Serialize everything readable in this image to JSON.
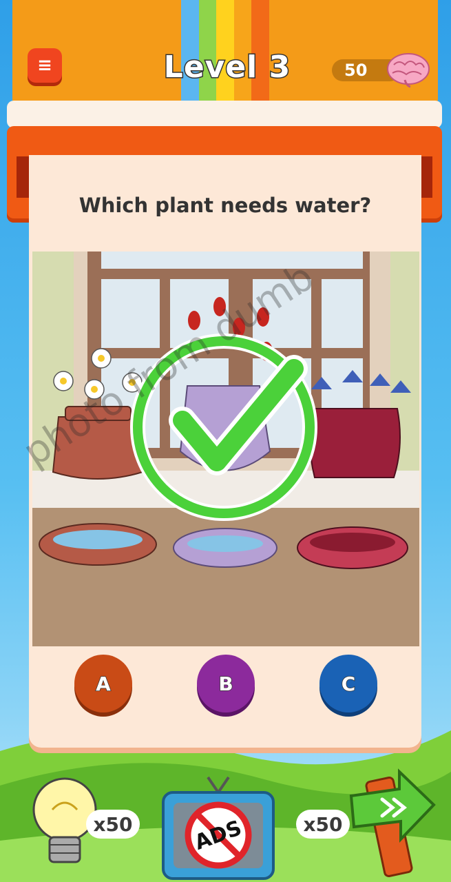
{
  "header": {
    "menu_icon": "menu-icon",
    "level_title": "Level 3",
    "coin_count": "50",
    "currency_icon": "brain-icon"
  },
  "question": {
    "text": "Which plant needs water?"
  },
  "answers": [
    {
      "label": "A",
      "color": "#c94b16"
    },
    {
      "label": "B",
      "color": "#8c2a9c"
    },
    {
      "label": "C",
      "color": "#1a62b5"
    }
  ],
  "result_icon": "checkmark-icon",
  "footer": {
    "hint_icon": "lightbulb-icon",
    "hint_cost": "x50",
    "remove_ads_icon": "no-ads-tv-icon",
    "remove_ads_label": "ADS",
    "skip_icon": "skip-arrow-icon",
    "skip_cost": "x50"
  },
  "watermark": "photo from dumb"
}
